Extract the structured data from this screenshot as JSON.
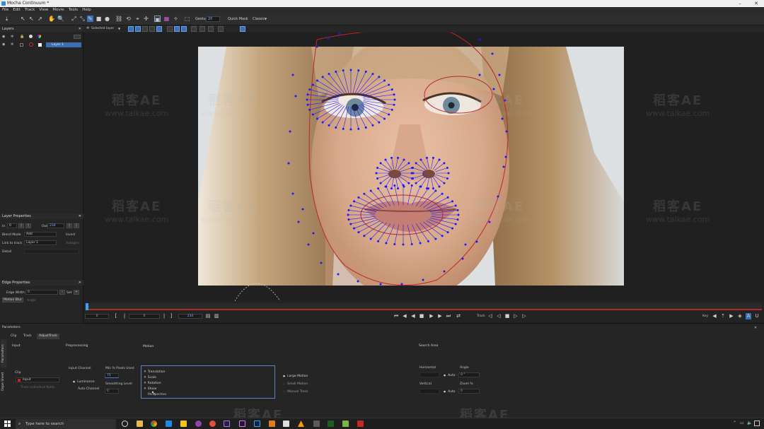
{
  "window": {
    "title": "Mocha Continuum *"
  },
  "menu": [
    "File",
    "Edit",
    "Track",
    "View",
    "Movie",
    "Tools",
    "Help"
  ],
  "toolbar": {
    "gesture_label": "Gesture",
    "gesture_value": "20",
    "quick_mask_label": "Quick Mask",
    "classic_label": "Classic"
  },
  "viewer_toolbar": {
    "layer_select": "Selected layer"
  },
  "layers_panel": {
    "title": "Layers",
    "layer_name": "Layer 1"
  },
  "layer_properties": {
    "title": "Layer Properties",
    "in_label": "In",
    "in_value": "0",
    "out_label": "Out",
    "out_value": "234",
    "blend_mode_label": "Blend Mode",
    "blend_mode_value": "Add",
    "invert_label": "Invert",
    "link_to_track_label": "Link to track",
    "link_to_track_value": "Layer 1",
    "autogen_label": "Autogen",
    "detail_label": "Detail"
  },
  "edge_properties": {
    "title": "Edge Properties",
    "edge_width_label": "Edge Width",
    "edge_width_value": "0",
    "set_label": "Set",
    "motion_blur_label": "Motion Blur",
    "angle_label": "Angle"
  },
  "timeline": {
    "start_value": "0",
    "current_value": "0",
    "end_value": "234",
    "track_label": "Track",
    "key_label": "Key"
  },
  "parameters": {
    "title": "Parameters",
    "tabs": [
      "Clip",
      "Track",
      "AdjustTrack"
    ],
    "active_tab": "Track",
    "side_tabs": [
      "Parameters",
      "Dope Sheet"
    ],
    "sections": {
      "input": "Input",
      "preprocessing": "Preprocessing",
      "motion": "Motion",
      "search_area": "Search Area"
    },
    "clip_label": "Clip",
    "clip_value": "Input",
    "track_individual_fields": "Track individual fields",
    "input_channel_label": "Input Channel",
    "luminance_label": "Luminance",
    "auto_channel_label": "Auto Channel",
    "min_pixels_label": "Min % Pixels Used",
    "min_pixels_value": "75",
    "smoothing_label": "Smoothing Level",
    "smoothing_value": "0",
    "motion_options": [
      "Translation",
      "Scale",
      "Rotation",
      "Shear",
      "Perspective"
    ],
    "motion_checked": [
      true,
      true,
      true,
      true,
      false
    ],
    "motion_modes": [
      "Large Motion",
      "Small Motion",
      "Manual Track"
    ],
    "horizontal_label": "Horizontal",
    "vertical_label": "Vertical",
    "auto_label": "Auto",
    "angle_label": "Angle",
    "angle_value": "0 °",
    "zoom_label": "Zoom %",
    "zoom_value": "0"
  },
  "taskbar": {
    "search_placeholder": "Type here to search"
  },
  "watermark": {
    "cn": "稻客AE",
    "en": "www.talkae.com"
  },
  "colors": {
    "accent": "#3d6db3",
    "spline": "#c0252a",
    "points": "#1a1aff",
    "timeline_red": "#b02a2a"
  }
}
